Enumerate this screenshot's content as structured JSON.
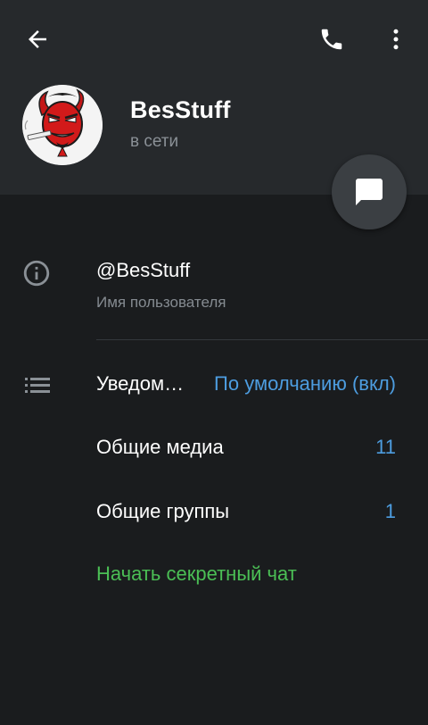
{
  "header": {
    "name": "BesStuff",
    "status": "в сети",
    "icons": {
      "back": "arrow-back-icon",
      "call": "phone-icon",
      "more": "more-vertical-icon",
      "message": "chat-bubble-icon"
    }
  },
  "info": {
    "username": "@BesStuff",
    "username_label": "Имя пользователя",
    "info_icon": "info-icon"
  },
  "settings": {
    "list_icon": "list-icon",
    "notifications": {
      "label": "Уведомления",
      "value": "По умолчанию (вкл)"
    },
    "shared_media": {
      "label": "Общие медиа",
      "value": "11"
    },
    "shared_groups": {
      "label": "Общие группы",
      "value": "1"
    },
    "secret_chat_label": "Начать секретный чат"
  },
  "colors": {
    "background": "#1a1c1e",
    "header_bg": "#26292c",
    "accent_blue": "#4d9de0",
    "accent_green": "#4bbf55",
    "secondary_text": "#858b91"
  }
}
